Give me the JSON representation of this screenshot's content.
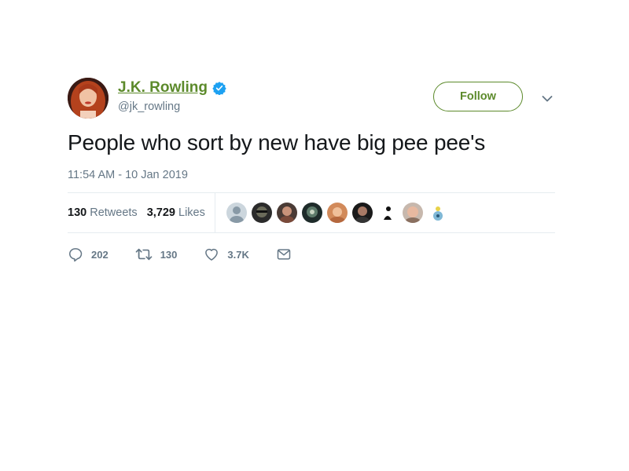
{
  "author": {
    "display_name": "J.K. Rowling",
    "handle": "@jk_rowling",
    "verified_icon": "verified-badge-icon"
  },
  "follow_button": {
    "label": "Follow"
  },
  "tweet": {
    "text": "People who sort by new have big pee pee's",
    "timestamp": "11:54 AM - 10 Jan 2019"
  },
  "stats": {
    "retweets_count": "130",
    "retweets_label": "Retweets",
    "likes_count": "3,729",
    "likes_label": "Likes"
  },
  "actions": {
    "reply_count": "202",
    "retweet_count": "130",
    "like_count": "3.7K"
  },
  "colors": {
    "link_green": "#5c8a2b",
    "verified_blue": "#1da1f2",
    "muted_gray": "#657786",
    "text_dark": "#14171a"
  }
}
